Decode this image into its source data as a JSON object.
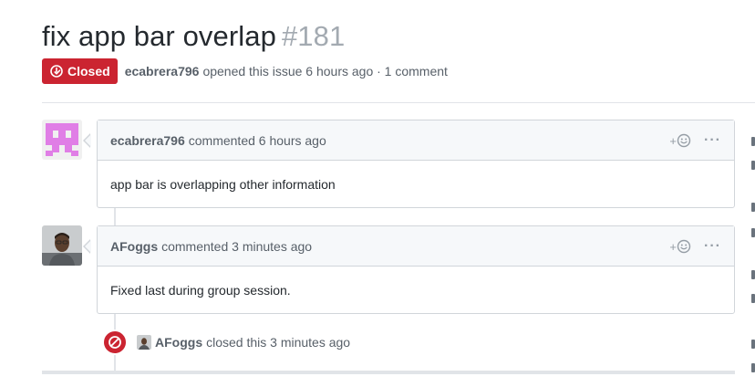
{
  "issue": {
    "title": "fix app bar overlap",
    "number": "#181",
    "state": "Closed",
    "author": "ecabrera796",
    "opened_text": "opened this issue 6 hours ago · 1 comment"
  },
  "comments": [
    {
      "author": "ecabrera796",
      "time_text": "commented 6 hours ago",
      "body": "app bar is overlapping other information",
      "reaction_label": "+",
      "more_label": "···"
    },
    {
      "author": "AFoggs",
      "time_text": "commented 3 minutes ago",
      "body": "Fixed last during group session.",
      "reaction_label": "+",
      "more_label": "···"
    }
  ],
  "close_event": {
    "actor": "AFoggs",
    "text": "closed this 3 minutes ago"
  },
  "colors": {
    "closed_red": "#cb2431",
    "identicon": "#e07ee6",
    "border": "#d1d5da",
    "header_bg": "#f6f8fa"
  }
}
